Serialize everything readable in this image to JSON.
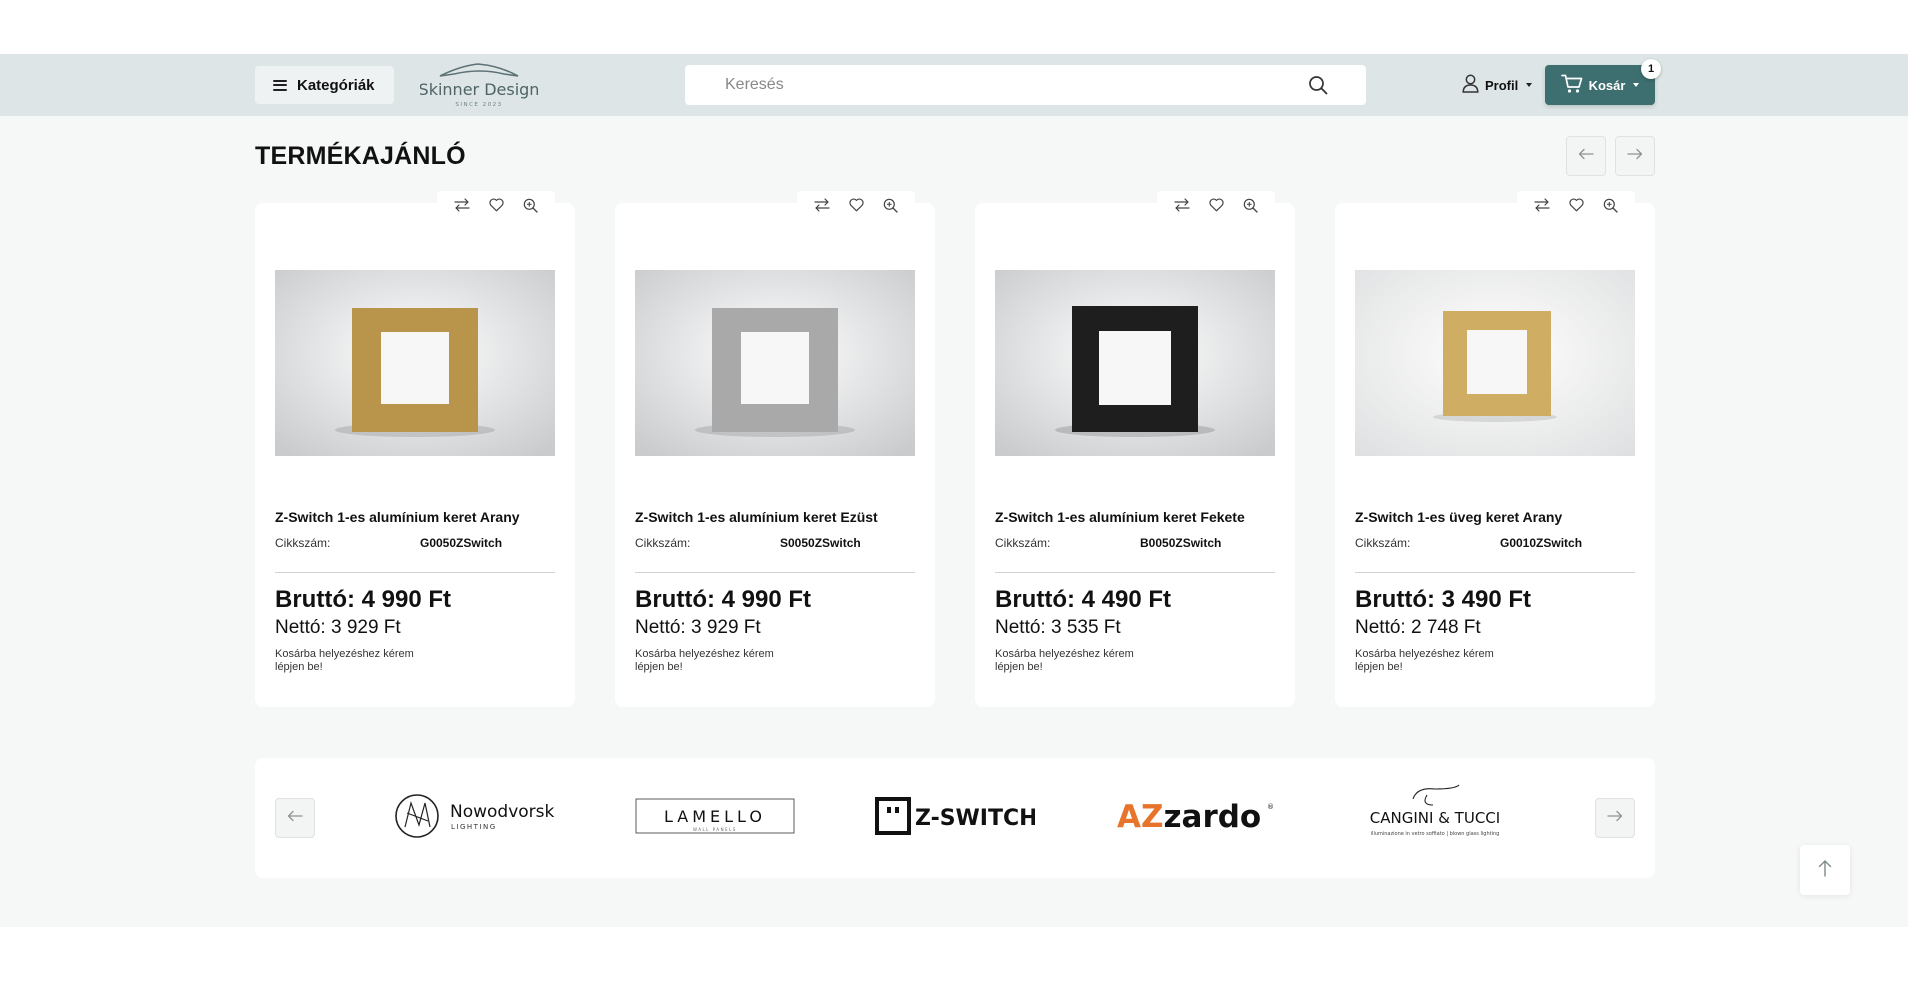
{
  "header": {
    "categories_label": "Kategóriák",
    "logo_text": "Skinner Design",
    "logo_tagline": "SINCE 2023",
    "search_placeholder": "Keresés",
    "profile_label": "Profil",
    "cart_label": "Kosár",
    "cart_count": "1"
  },
  "section": {
    "title": "TERMÉKAJÁNLÓ"
  },
  "products": [
    {
      "name": "Z-Switch 1-es alumínium keret Arany",
      "sku_label": "Cikkszám:",
      "sku": "G0050ZSwitch",
      "gross": "Bruttó: 4 990 Ft",
      "net": "Nettó: 3 929 Ft",
      "note": "Kosárba helyezéshez kérem lépjen be!",
      "frame_color": "#b8954a"
    },
    {
      "name": "Z-Switch 1-es alumínium keret Ezüst",
      "sku_label": "Cikkszám:",
      "sku": "S0050ZSwitch",
      "gross": "Bruttó: 4 990 Ft",
      "net": "Nettó: 3 929 Ft",
      "note": "Kosárba helyezéshez kérem lépjen be!",
      "frame_color": "#a9a9a9"
    },
    {
      "name": "Z-Switch 1-es alumínium keret Fekete",
      "sku_label": "Cikkszám:",
      "sku": "B0050ZSwitch",
      "gross": "Bruttó: 4 490 Ft",
      "net": "Nettó: 3 535 Ft",
      "note": "Kosárba helyezéshez kérem lépjen be!",
      "frame_color": "#1e1e1e"
    },
    {
      "name": "Z-Switch 1-es üveg keret Arany",
      "sku_label": "Cikkszám:",
      "sku": "G0010ZSwitch",
      "gross": "Bruttó: 3 490 Ft",
      "net": "Nettó: 2 748 Ft",
      "note": "Kosárba helyezéshez kérem lépjen be!",
      "frame_color": "#cfae63"
    }
  ],
  "brands": [
    {
      "name": "Nowodvorski",
      "sub": "LIGHTING"
    },
    {
      "name": "LAMELLO",
      "sub": "WALL PANELS"
    },
    {
      "name": "Z-SWITCH"
    },
    {
      "name": "AZzardo"
    },
    {
      "name": "CANGINI & TUCCI",
      "sub": "illuminazione in vetro soffiato | blown glass lighting"
    }
  ],
  "colors": {
    "header_bg": "#dde5e6",
    "cart_bg": "#3d6e70",
    "page_bg": "#f6f7f7",
    "azzardo_orange": "#e8742b"
  },
  "icons": {
    "menu": "hamburger-icon",
    "search": "search-icon",
    "profile": "user-icon",
    "cart": "cart-icon",
    "compare": "compare-icon",
    "wishlist": "heart-icon",
    "zoom": "zoom-icon",
    "prev": "arrow-left-icon",
    "next": "arrow-right-icon",
    "top": "arrow-up-icon"
  }
}
